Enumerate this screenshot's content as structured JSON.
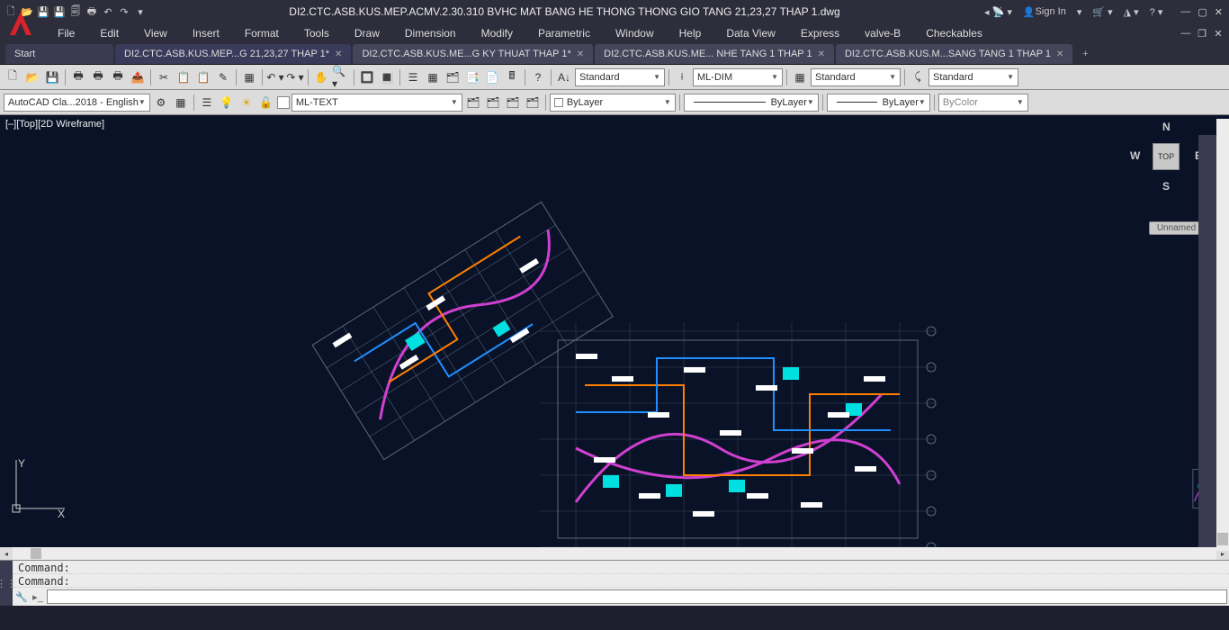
{
  "titlebar": {
    "title": "DI2.CTC.ASB.KUS.MEP.ACMV.2.30.310 BVHC MAT BANG HE THONG THONG GIO TANG 21,23,27 THAP 1.dwg",
    "signin": "Sign In"
  },
  "menu": {
    "items": [
      "File",
      "Edit",
      "View",
      "Insert",
      "Format",
      "Tools",
      "Draw",
      "Dimension",
      "Modify",
      "Parametric",
      "Window",
      "Help",
      "Data View",
      "Express",
      "valve-B",
      "Checkables"
    ]
  },
  "tabs": {
    "start": "Start",
    "items": [
      {
        "label": "DI2.CTC.ASB.KUS.MEP...G 21,23,27 THAP 1*",
        "active": true,
        "close": true
      },
      {
        "label": "DI2.CTC.ASB.KUS.ME...G KY THUAT THAP 1*",
        "active": false,
        "close": true
      },
      {
        "label": "DI2.CTC.ASB.KUS.ME... NHE TANG 1 THAP 1",
        "active": false,
        "close": true
      },
      {
        "label": "DI2.CTC.ASB.KUS.M...SANG TANG 1 THAP 1",
        "active": false,
        "close": true
      }
    ]
  },
  "toolbar1": {
    "text_style": "Standard",
    "dim_style": "ML-DIM",
    "table_style": "Standard",
    "mleader_style": "Standard"
  },
  "toolbar2": {
    "workspace": "AutoCAD Cla...2018 - English",
    "mltext": "ML-TEXT",
    "layer_match": "ByLayer",
    "linetype": "ByLayer",
    "lineweight": "ByLayer",
    "plotcolor": "ByColor"
  },
  "viewport": {
    "label": "[–][Top][2D Wireframe]"
  },
  "navcube": {
    "face": "TOP",
    "n": "N",
    "s": "S",
    "e": "E",
    "w": "W",
    "view_btn": "Unnamed"
  },
  "ucs": {
    "y": "Y",
    "x": "X"
  },
  "command": {
    "line1": "Command:",
    "line2": "Command:",
    "prompt": ""
  }
}
